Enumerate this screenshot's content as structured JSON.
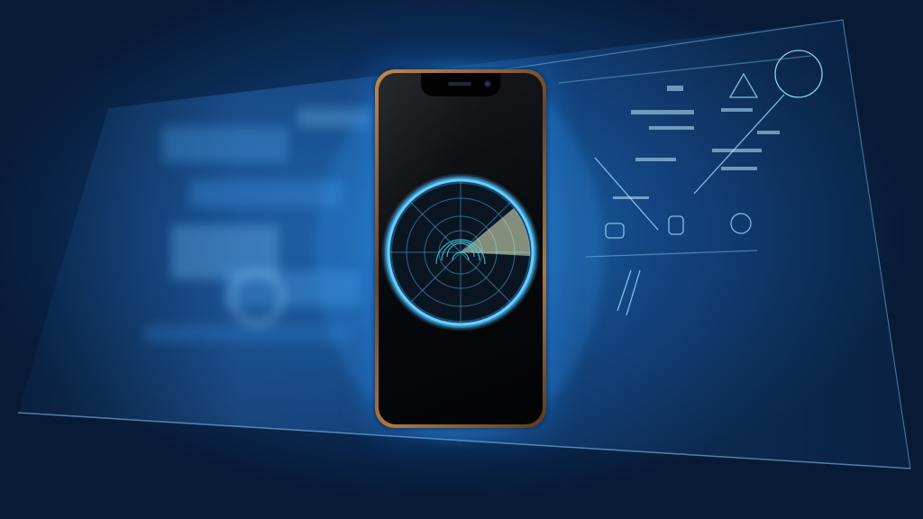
{
  "scene": {
    "background_color": "#071a36",
    "glow_color": "#3aa8ff",
    "phone_frame_color": "#b07a3e",
    "phone_screen_color": "#07080b"
  },
  "icons": {
    "scanner": "fingerprint-scanner-icon",
    "triangle": "warning-triangle-icon",
    "globe": "globe-icon",
    "badge_a": "lock-badge-icon",
    "badge_b": "shield-badge-icon",
    "badge_c": "gauge-badge-icon"
  }
}
